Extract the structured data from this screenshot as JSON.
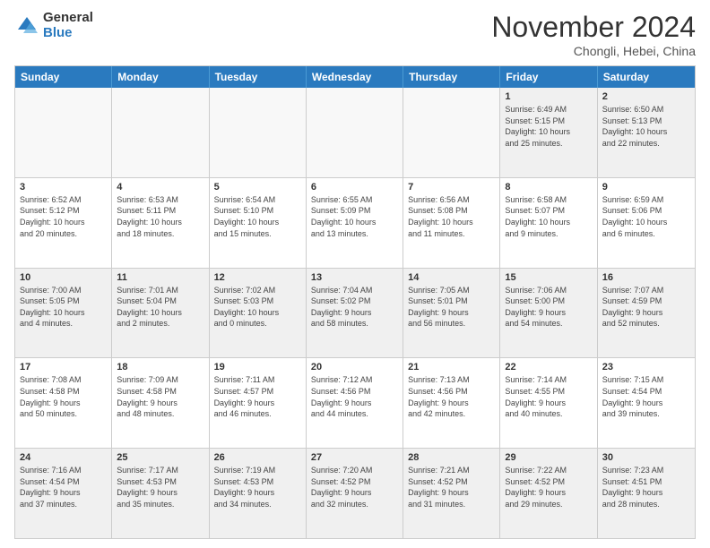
{
  "logo": {
    "general": "General",
    "blue": "Blue"
  },
  "header": {
    "month": "November 2024",
    "location": "Chongli, Hebei, China"
  },
  "weekdays": [
    "Sunday",
    "Monday",
    "Tuesday",
    "Wednesday",
    "Thursday",
    "Friday",
    "Saturday"
  ],
  "rows": [
    [
      {
        "day": "",
        "info": ""
      },
      {
        "day": "",
        "info": ""
      },
      {
        "day": "",
        "info": ""
      },
      {
        "day": "",
        "info": ""
      },
      {
        "day": "",
        "info": ""
      },
      {
        "day": "1",
        "info": "Sunrise: 6:49 AM\nSunset: 5:15 PM\nDaylight: 10 hours\nand 25 minutes."
      },
      {
        "day": "2",
        "info": "Sunrise: 6:50 AM\nSunset: 5:13 PM\nDaylight: 10 hours\nand 22 minutes."
      }
    ],
    [
      {
        "day": "3",
        "info": "Sunrise: 6:52 AM\nSunset: 5:12 PM\nDaylight: 10 hours\nand 20 minutes."
      },
      {
        "day": "4",
        "info": "Sunrise: 6:53 AM\nSunset: 5:11 PM\nDaylight: 10 hours\nand 18 minutes."
      },
      {
        "day": "5",
        "info": "Sunrise: 6:54 AM\nSunset: 5:10 PM\nDaylight: 10 hours\nand 15 minutes."
      },
      {
        "day": "6",
        "info": "Sunrise: 6:55 AM\nSunset: 5:09 PM\nDaylight: 10 hours\nand 13 minutes."
      },
      {
        "day": "7",
        "info": "Sunrise: 6:56 AM\nSunset: 5:08 PM\nDaylight: 10 hours\nand 11 minutes."
      },
      {
        "day": "8",
        "info": "Sunrise: 6:58 AM\nSunset: 5:07 PM\nDaylight: 10 hours\nand 9 minutes."
      },
      {
        "day": "9",
        "info": "Sunrise: 6:59 AM\nSunset: 5:06 PM\nDaylight: 10 hours\nand 6 minutes."
      }
    ],
    [
      {
        "day": "10",
        "info": "Sunrise: 7:00 AM\nSunset: 5:05 PM\nDaylight: 10 hours\nand 4 minutes."
      },
      {
        "day": "11",
        "info": "Sunrise: 7:01 AM\nSunset: 5:04 PM\nDaylight: 10 hours\nand 2 minutes."
      },
      {
        "day": "12",
        "info": "Sunrise: 7:02 AM\nSunset: 5:03 PM\nDaylight: 10 hours\nand 0 minutes."
      },
      {
        "day": "13",
        "info": "Sunrise: 7:04 AM\nSunset: 5:02 PM\nDaylight: 9 hours\nand 58 minutes."
      },
      {
        "day": "14",
        "info": "Sunrise: 7:05 AM\nSunset: 5:01 PM\nDaylight: 9 hours\nand 56 minutes."
      },
      {
        "day": "15",
        "info": "Sunrise: 7:06 AM\nSunset: 5:00 PM\nDaylight: 9 hours\nand 54 minutes."
      },
      {
        "day": "16",
        "info": "Sunrise: 7:07 AM\nSunset: 4:59 PM\nDaylight: 9 hours\nand 52 minutes."
      }
    ],
    [
      {
        "day": "17",
        "info": "Sunrise: 7:08 AM\nSunset: 4:58 PM\nDaylight: 9 hours\nand 50 minutes."
      },
      {
        "day": "18",
        "info": "Sunrise: 7:09 AM\nSunset: 4:58 PM\nDaylight: 9 hours\nand 48 minutes."
      },
      {
        "day": "19",
        "info": "Sunrise: 7:11 AM\nSunset: 4:57 PM\nDaylight: 9 hours\nand 46 minutes."
      },
      {
        "day": "20",
        "info": "Sunrise: 7:12 AM\nSunset: 4:56 PM\nDaylight: 9 hours\nand 44 minutes."
      },
      {
        "day": "21",
        "info": "Sunrise: 7:13 AM\nSunset: 4:56 PM\nDaylight: 9 hours\nand 42 minutes."
      },
      {
        "day": "22",
        "info": "Sunrise: 7:14 AM\nSunset: 4:55 PM\nDaylight: 9 hours\nand 40 minutes."
      },
      {
        "day": "23",
        "info": "Sunrise: 7:15 AM\nSunset: 4:54 PM\nDaylight: 9 hours\nand 39 minutes."
      }
    ],
    [
      {
        "day": "24",
        "info": "Sunrise: 7:16 AM\nSunset: 4:54 PM\nDaylight: 9 hours\nand 37 minutes."
      },
      {
        "day": "25",
        "info": "Sunrise: 7:17 AM\nSunset: 4:53 PM\nDaylight: 9 hours\nand 35 minutes."
      },
      {
        "day": "26",
        "info": "Sunrise: 7:19 AM\nSunset: 4:53 PM\nDaylight: 9 hours\nand 34 minutes."
      },
      {
        "day": "27",
        "info": "Sunrise: 7:20 AM\nSunset: 4:52 PM\nDaylight: 9 hours\nand 32 minutes."
      },
      {
        "day": "28",
        "info": "Sunrise: 7:21 AM\nSunset: 4:52 PM\nDaylight: 9 hours\nand 31 minutes."
      },
      {
        "day": "29",
        "info": "Sunrise: 7:22 AM\nSunset: 4:52 PM\nDaylight: 9 hours\nand 29 minutes."
      },
      {
        "day": "30",
        "info": "Sunrise: 7:23 AM\nSunset: 4:51 PM\nDaylight: 9 hours\nand 28 minutes."
      }
    ]
  ]
}
